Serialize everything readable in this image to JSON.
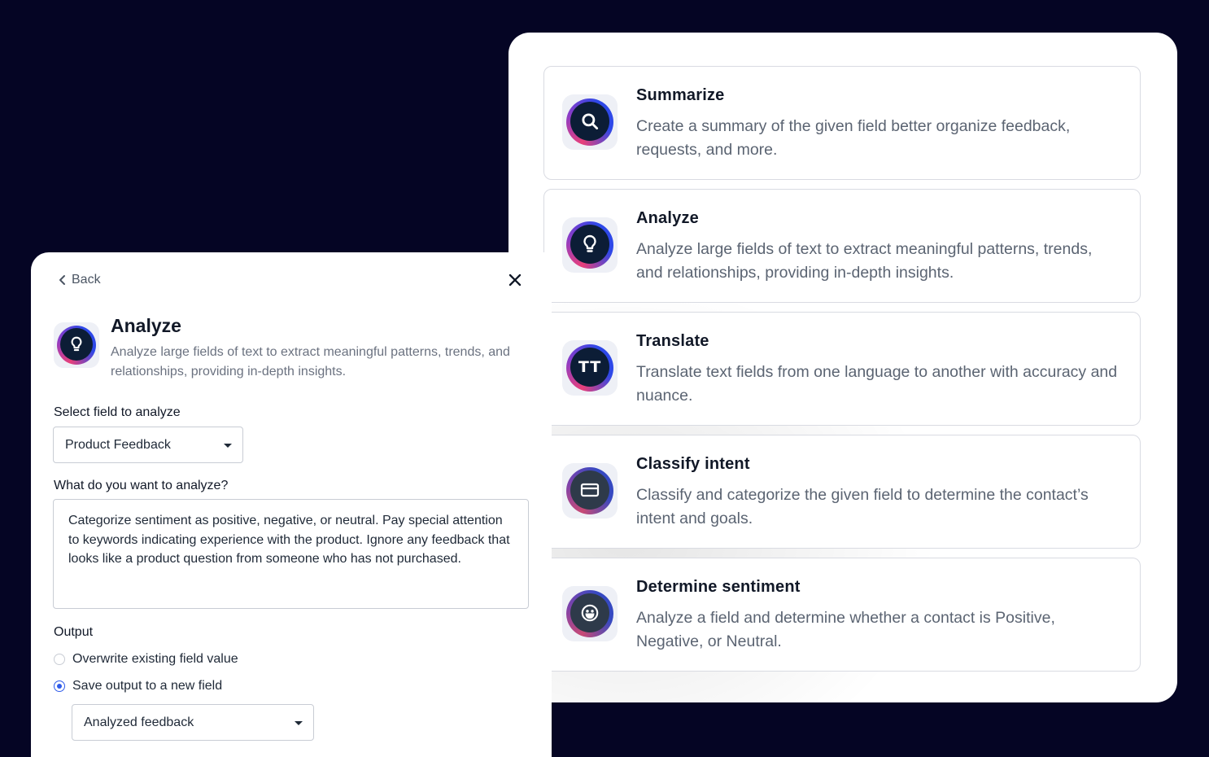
{
  "capabilities": [
    {
      "title": "Summarize",
      "description": "Create a summary of the given field better organize feedback, requests, and more.",
      "icon": "search-icon"
    },
    {
      "title": "Analyze",
      "description": "Analyze large fields of text to extract meaningful patterns, trends, and relationships, providing in-depth insights.",
      "icon": "lightbulb-icon"
    },
    {
      "title": "Translate",
      "description": "Translate text fields from one language to another with accuracy and nuance.",
      "icon": "translate-icon",
      "icon_text": "TT"
    },
    {
      "title": "Classify intent",
      "description": "Classify and categorize the given field to determine the contact’s intent and goals.",
      "icon": "folder-icon"
    },
    {
      "title": "Determine sentiment",
      "description": "Analyze a field and determine whether a contact is Positive, Negative, or Neutral.",
      "icon": "smiley-icon"
    }
  ],
  "analyze_panel": {
    "back_label": "Back",
    "title": "Analyze",
    "description": "Analyze large fields of text to extract meaningful patterns, trends, and relationships, providing in-depth insights.",
    "field_label": "Select field to analyze",
    "field_value": "Product Feedback",
    "prompt_label": "What do you want to analyze?",
    "prompt_value": "Categorize sentiment as positive, negative, or neutral. Pay special attention to keywords indicating experience with the product. Ignore any feedback that looks like a product question from someone who has not purchased.",
    "output_label": "Output",
    "output_options": [
      {
        "label": "Overwrite existing field value",
        "selected": false
      },
      {
        "label": "Save output to a new field",
        "selected": true
      }
    ],
    "output_field_value": "Analyzed feedback"
  },
  "colors": {
    "background": "#050524",
    "accent_blue": "#2f5bea",
    "icon_ring_pink": "#e8407a",
    "icon_ring_blue": "#2e48e8",
    "icon_fill": "#0c1d36"
  }
}
